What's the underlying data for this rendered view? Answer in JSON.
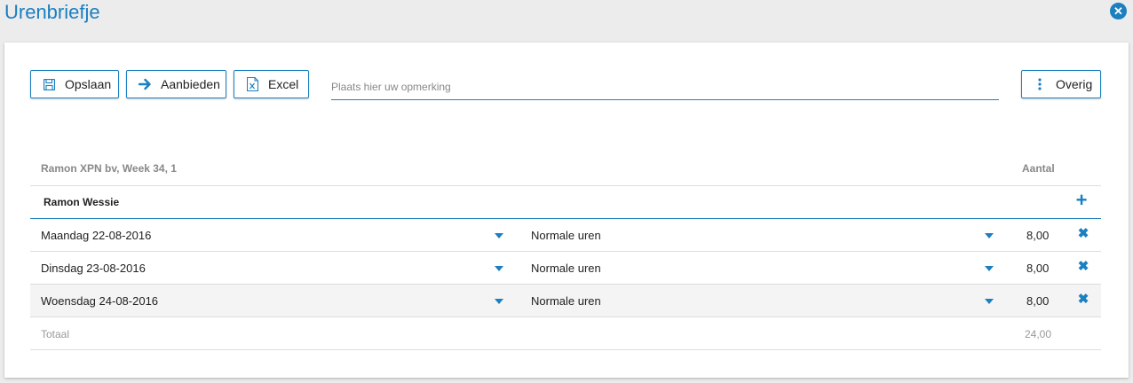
{
  "window": {
    "title": "Urenbriefje"
  },
  "toolbar": {
    "save_label": "Opslaan",
    "offer_label": "Aanbieden",
    "excel_label": "Excel",
    "more_label": "Overig",
    "remark_placeholder": "Plaats hier uw opmerking"
  },
  "table": {
    "header_left": "Ramon XPN bv, Week 34, 1",
    "header_right": "Aantal",
    "person": "Ramon Wessie",
    "rows": [
      {
        "date": "Maandag 22-08-2016",
        "type": "Normale uren",
        "amount": "8,00"
      },
      {
        "date": "Dinsdag 23-08-2016",
        "type": "Normale uren",
        "amount": "8,00"
      },
      {
        "date": "Woensdag 24-08-2016",
        "type": "Normale uren",
        "amount": "8,00"
      }
    ],
    "total_label": "Totaal",
    "total_value": "24,00"
  },
  "colors": {
    "accent": "#1b7fc0",
    "background": "#ececec",
    "alt_row": "#f4f4f4"
  }
}
